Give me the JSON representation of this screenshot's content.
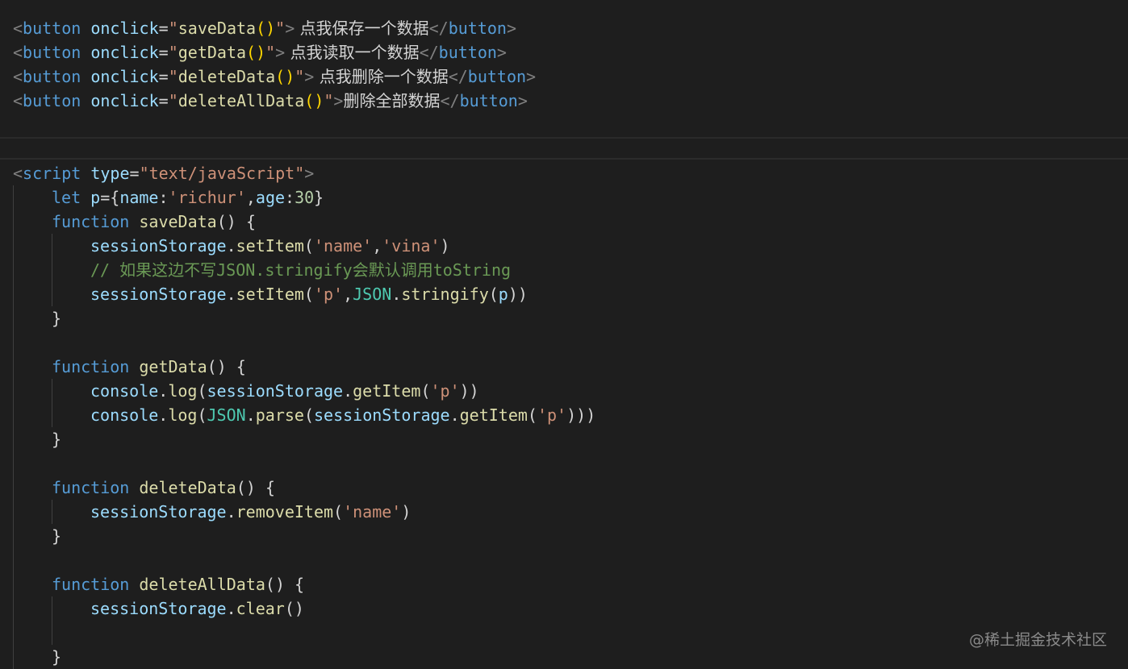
{
  "top": {
    "b1": {
      "open": "<",
      "tag": "button",
      "attr": "onclick",
      "eq": "=",
      "q": "\"",
      "fn": "saveData",
      "parens": "()",
      "gt": ">",
      "text": " 点我保存一个数据",
      "close_open": "</",
      "close_tag": "button",
      "close_gt": ">"
    },
    "b2": {
      "open": "<",
      "tag": "button",
      "attr": "onclick",
      "eq": "=",
      "q": "\"",
      "fn": "getData",
      "parens": "()",
      "gt": ">",
      "text": " 点我读取一个数据",
      "close_open": "</",
      "close_tag": "button",
      "close_gt": ">"
    },
    "b3": {
      "open": "<",
      "tag": "button",
      "attr": "onclick",
      "eq": "=",
      "q": "\"",
      "fn": "deleteData",
      "parens": "()",
      "gt": ">",
      "text": " 点我删除一个数据",
      "close_open": "</",
      "close_tag": "button",
      "close_gt": ">"
    },
    "b4": {
      "open": "<",
      "tag": "button",
      "attr": "onclick",
      "eq": "=",
      "q": "\"",
      "fn": "deleteAllData",
      "parens": "()",
      "gt": ">",
      "text": "删除全部数据",
      "close_open": "</",
      "close_tag": "button",
      "close_gt": ">"
    }
  },
  "code": {
    "script_open": "<",
    "script_tag": "script",
    "script_attr": "type",
    "script_eq": "=",
    "script_val": "\"text/javaScript\"",
    "script_gt": ">",
    "let_kw": "let",
    "let_var": "p",
    "let_rest1": "={",
    "let_name_key": "name",
    "let_colon1": ":",
    "let_name_val": "'richur'",
    "let_comma": ",",
    "let_age_key": "age",
    "let_colon2": ":",
    "let_age_val": "30",
    "let_close": "}",
    "function_kw": "function",
    "f1_name": "saveData",
    "f2_name": "getData",
    "f3_name": "deleteData",
    "f4_name": "deleteAllData",
    "sig_rest": "() {",
    "close_brace": "}",
    "sessionStorage": "sessionStorage",
    "dot": ".",
    "setItem": "setItem",
    "getItem": "getItem",
    "removeItem": "removeItem",
    "clear": "clear",
    "lp": "(",
    "rp": ")",
    "comma": ",",
    "s_name": "'name'",
    "s_vina": "'vina'",
    "s_p": "'p'",
    "comment": "// 如果这边不写JSON.stringify会默认调用toString",
    "JSON": "JSON",
    "stringify": "stringify",
    "parse": "parse",
    "p": "p",
    "console": "console",
    "log": "log",
    "empty_parens": "()"
  },
  "watermark": "@稀土掘金技术社区"
}
